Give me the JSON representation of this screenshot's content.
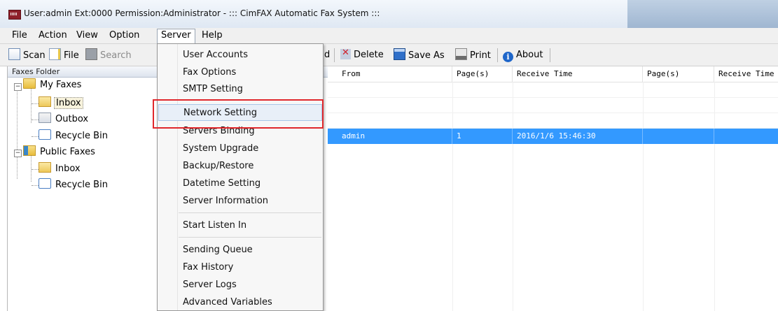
{
  "window": {
    "title": "User:admin  Ext:0000  Permission:Administrator - ::: CimFAX Automatic Fax System :::"
  },
  "menubar": {
    "items": [
      {
        "label": "File"
      },
      {
        "label": "Action"
      },
      {
        "label": "View"
      },
      {
        "label": "Option"
      },
      {
        "label": "Server",
        "active": true
      },
      {
        "label": "Help"
      }
    ]
  },
  "toolbar": {
    "scan": "Scan",
    "file": "File",
    "search": "Search",
    "partial": "d",
    "delete": "Delete",
    "save_as": "Save As",
    "print": "Print",
    "about": "About",
    "about_glyph": "i"
  },
  "tree": {
    "header": "Faxes Folder",
    "expand_glyph": "−",
    "my_faxes": "My Faxes",
    "inbox": "Inbox",
    "outbox": "Outbox",
    "recycle": "Recycle Bin",
    "public_faxes": "Public Faxes",
    "public_inbox": "Inbox",
    "public_recycle": "Recycle Bin"
  },
  "list": {
    "columns": [
      "From",
      "Page(s)",
      "Receive Time",
      "Page(s)",
      "Receive Time"
    ],
    "rows": [
      {
        "from": "admin",
        "pages": "1",
        "receive_time": "2016/1/6 15:46:30",
        "selected": true
      }
    ]
  },
  "server_menu": {
    "items": [
      "User Accounts",
      "Fax Options",
      "SMTP Setting",
      "Network Setting",
      "Servers Binding",
      "System Upgrade",
      "Backup/Restore",
      "Datetime Setting",
      "Server Information",
      "Start Listen In",
      "Sending Queue",
      "Fax History",
      "Server Logs",
      "Advanced Variables"
    ],
    "highlighted": "Network Setting"
  },
  "colors": {
    "selection": "#3399ff",
    "highlight_box": "#e0282c",
    "titlebar": "#dfe8f3"
  }
}
